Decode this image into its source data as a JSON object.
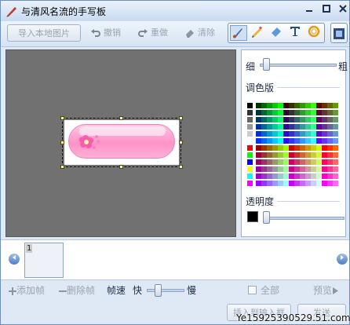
{
  "window": {
    "title": "与清风名流的手写板"
  },
  "toolbar": {
    "import_label": "导入本地图片",
    "undo_label": "撤销",
    "redo_label": "重做",
    "clear_label": "清除"
  },
  "panel": {
    "thin_label": "细",
    "thick_label": "粗",
    "palette_label": "调色版",
    "opacity_label": "透明度"
  },
  "frames": {
    "thumbs": [
      {
        "number": "1"
      }
    ]
  },
  "controls": {
    "add_frame_label": "添加帧",
    "delete_frame_label": "删除帧",
    "frame_speed_label": "帧速",
    "fast_label": "快",
    "slow_label": "慢",
    "select_all_label": "全部",
    "preview_label": "预览"
  },
  "bottom": {
    "insert_label": "插入到输入框",
    "send_label": "发送"
  },
  "watermark": {
    "text": "Ye15925390529.51.com"
  },
  "colors": {
    "canvas_bg": "#717171",
    "accent": "#4f7fc2",
    "selected_color": "#000000"
  },
  "palette": {
    "rows": [
      [
        "#000000",
        "#003300",
        "#006600",
        "#009900",
        "#00cc00",
        "#00ff00",
        "#330000",
        "#333300",
        "#336600",
        "#339900",
        "#33cc00",
        "#33ff00",
        "#660000",
        "#663300",
        "#666600",
        "#669900"
      ],
      [
        "#333333",
        "#003333",
        "#006633",
        "#009933",
        "#00cc33",
        "#00ff33",
        "#330033",
        "#333333",
        "#336633",
        "#339933",
        "#33cc33",
        "#33ff33",
        "#660033",
        "#663333",
        "#666633",
        "#669933"
      ],
      [
        "#666666",
        "#003366",
        "#006666",
        "#009966",
        "#00cc66",
        "#00ff66",
        "#330066",
        "#333366",
        "#336666",
        "#339966",
        "#33cc66",
        "#33ff66",
        "#660066",
        "#663366",
        "#666666",
        "#669966"
      ],
      [
        "#999999",
        "#003399",
        "#006699",
        "#009999",
        "#00cc99",
        "#00ff99",
        "#330099",
        "#333399",
        "#336699",
        "#339999",
        "#33cc99",
        "#33ff99",
        "#660099",
        "#663399",
        "#666699",
        "#669999"
      ],
      [
        "#cccccc",
        "#0033cc",
        "#0066cc",
        "#0099cc",
        "#00cccc",
        "#00ffcc",
        "#3300cc",
        "#3333cc",
        "#3366cc",
        "#3399cc",
        "#33cccc",
        "#33ffcc",
        "#6600cc",
        "#6633cc",
        "#6666cc",
        "#6699cc"
      ],
      [
        "#ffffff",
        "#0033ff",
        "#0066ff",
        "#0099ff",
        "#00ccff",
        "#00ffff",
        "#3300ff",
        "#3333ff",
        "#3366ff",
        "#3399ff",
        "#33ccff",
        "#33ffff",
        "#6600ff",
        "#6633ff",
        "#6666ff",
        "#6699ff"
      ],
      [
        "#ff0000",
        "#990000",
        "#993300",
        "#996600",
        "#999900",
        "#99cc00",
        "#99ff00",
        "#cc0000",
        "#cc3300",
        "#cc6600",
        "#cc9900",
        "#cccc00",
        "#ccff00",
        "#ff0000",
        "#ff3300",
        "#ff6600"
      ],
      [
        "#00ff00",
        "#990033",
        "#993333",
        "#996633",
        "#999933",
        "#99cc33",
        "#99ff33",
        "#cc0033",
        "#cc3333",
        "#cc6633",
        "#cc9933",
        "#cccc33",
        "#ccff33",
        "#ff0033",
        "#ff3333",
        "#ff6633"
      ],
      [
        "#0000ff",
        "#990066",
        "#993366",
        "#996666",
        "#999966",
        "#99cc66",
        "#99ff66",
        "#cc0066",
        "#cc3366",
        "#cc6666",
        "#cc9966",
        "#cccc66",
        "#ccff66",
        "#ff0066",
        "#ff3366",
        "#ff6666"
      ],
      [
        "#ffff00",
        "#990099",
        "#993399",
        "#996699",
        "#999999",
        "#99cc99",
        "#99ff99",
        "#cc0099",
        "#cc3399",
        "#cc6699",
        "#cc9999",
        "#cccc99",
        "#ccff99",
        "#ff0099",
        "#ff3399",
        "#ff6699"
      ],
      [
        "#00ffff",
        "#9900cc",
        "#9933cc",
        "#9966cc",
        "#9999cc",
        "#99cccc",
        "#99ffcc",
        "#cc00cc",
        "#cc33cc",
        "#cc66cc",
        "#cc99cc",
        "#cccccc",
        "#ccffcc",
        "#ff00cc",
        "#ff33cc",
        "#ff66cc"
      ],
      [
        "#ff00ff",
        "#9900ff",
        "#9933ff",
        "#9966ff",
        "#9999ff",
        "#99ccff",
        "#99ffff",
        "#cc00ff",
        "#cc33ff",
        "#cc66ff",
        "#cc99ff",
        "#ccccff",
        "#ccffff",
        "#ff00ff",
        "#ff33ff",
        "#ff66ff"
      ]
    ]
  }
}
